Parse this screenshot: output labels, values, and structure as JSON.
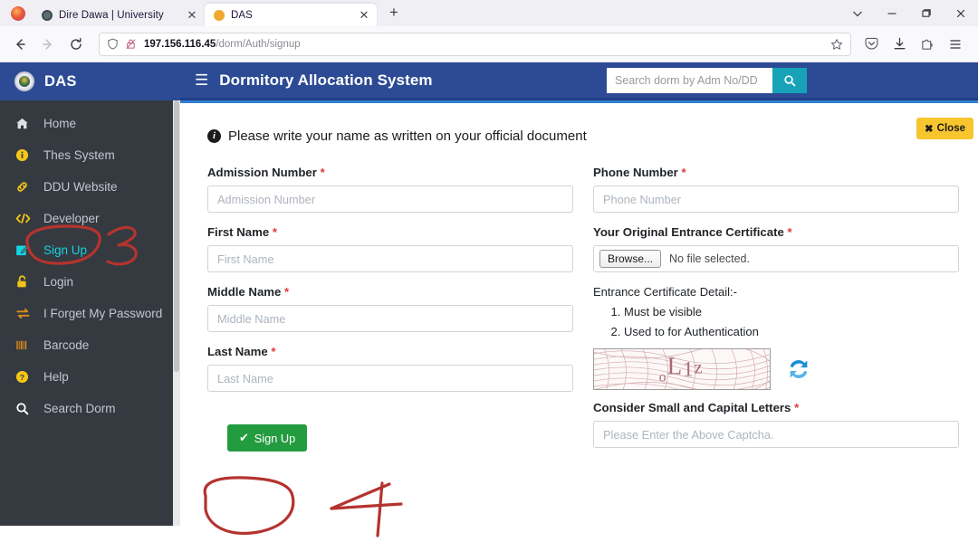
{
  "browser": {
    "tabs": [
      {
        "title": "Dire Dawa | University",
        "active": false,
        "favicon": "globe-icon"
      },
      {
        "title": "DAS",
        "active": true,
        "favicon": "orange-dot-icon"
      }
    ],
    "new_tab_label": "+",
    "window_controls": {
      "list_all_tabs": "⌄",
      "minimize": "−",
      "maximize": "❐",
      "close": "✕"
    },
    "nav": {
      "back": "←",
      "forward": "→",
      "reload": "⟳"
    },
    "url": {
      "host": "197.156.116.45",
      "path": "/dorm/Auth/signup"
    },
    "toolbar_right": [
      "pocket-icon",
      "downloads-icon",
      "extensions-icon",
      "app-menu-icon"
    ]
  },
  "sidebar": {
    "brand": "DAS",
    "items": [
      {
        "label": "Home",
        "icon": "home-icon",
        "active": false
      },
      {
        "label": "Thes System",
        "icon": "info-icon",
        "active": false
      },
      {
        "label": "DDU Website",
        "icon": "link-icon",
        "active": false
      },
      {
        "label": "Developer",
        "icon": "code-icon",
        "active": false
      },
      {
        "label": "Sign Up",
        "icon": "edit-icon",
        "active": true
      },
      {
        "label": "Login",
        "icon": "unlock-icon",
        "active": false
      },
      {
        "label": "I Forget My Password",
        "icon": "exchange-icon",
        "active": false
      },
      {
        "label": "Barcode",
        "icon": "barcode-icon",
        "active": false
      },
      {
        "label": "Help",
        "icon": "question-icon",
        "active": false
      },
      {
        "label": "Search Dorm",
        "icon": "search-icon",
        "active": false
      }
    ]
  },
  "topbar": {
    "menu_icon": "hamburger-icon",
    "title": "Dormitory Allocation System",
    "search": {
      "placeholder": "Search dorm by Adm No/DD",
      "value": "",
      "button_icon": "search-icon"
    }
  },
  "alert": {
    "icon": "info-circle-icon",
    "message": "Please write your name as written on your official document",
    "close_label": "Close",
    "close_icon": "✖"
  },
  "form": {
    "left": [
      {
        "label": "Admission Number",
        "required": "*",
        "placeholder": "Admission Number",
        "value": ""
      },
      {
        "label": "First Name",
        "required": "*",
        "placeholder": "First Name",
        "value": ""
      },
      {
        "label": "Middle Name",
        "required": "*",
        "placeholder": "Middle Name",
        "value": ""
      },
      {
        "label": "Last Name",
        "required": "*",
        "placeholder": "Last Name",
        "value": ""
      }
    ],
    "phone": {
      "label": "Phone Number",
      "required": "*",
      "placeholder": "Phone Number",
      "value": ""
    },
    "certificate": {
      "label": "Your Original Entrance Certificate",
      "required": "*",
      "browse_label": "Browse...",
      "file_status": "No file selected."
    },
    "certificate_detail": {
      "heading": "Entrance Certificate Detail:-",
      "items": [
        "Must be visible",
        "Used to for Authentication"
      ]
    },
    "captcha": {
      "text": "oL1z",
      "chars": [
        "o",
        "L",
        "1",
        "z"
      ],
      "refresh_icon": "refresh-icon",
      "label": "Consider Small and Capital Letters",
      "required": "*",
      "placeholder": "Please Enter the Above Captcha.",
      "value": ""
    },
    "submit": {
      "label": "Sign Up",
      "icon": "✔"
    }
  },
  "annotations": [
    {
      "type": "ellipse",
      "target": "sidebar-item-sign-up",
      "color": "#b5332f"
    },
    {
      "type": "handwritten-number",
      "text": "3",
      "color": "#b5332f"
    },
    {
      "type": "ellipse",
      "target": "signup-button",
      "color": "#b5332f"
    },
    {
      "type": "handwritten-number",
      "text": "4",
      "color": "#b5332f"
    }
  ],
  "colors": {
    "brand_blue": "#2d4b94",
    "sidebar_dark": "#343a40",
    "active_cyan": "#17d2e0",
    "accent_teal": "#17a2b8",
    "warning_yellow": "#f7c52d",
    "success_green": "#239b3f",
    "required_red": "#e23b3b",
    "annotation_red": "#b5332f"
  }
}
